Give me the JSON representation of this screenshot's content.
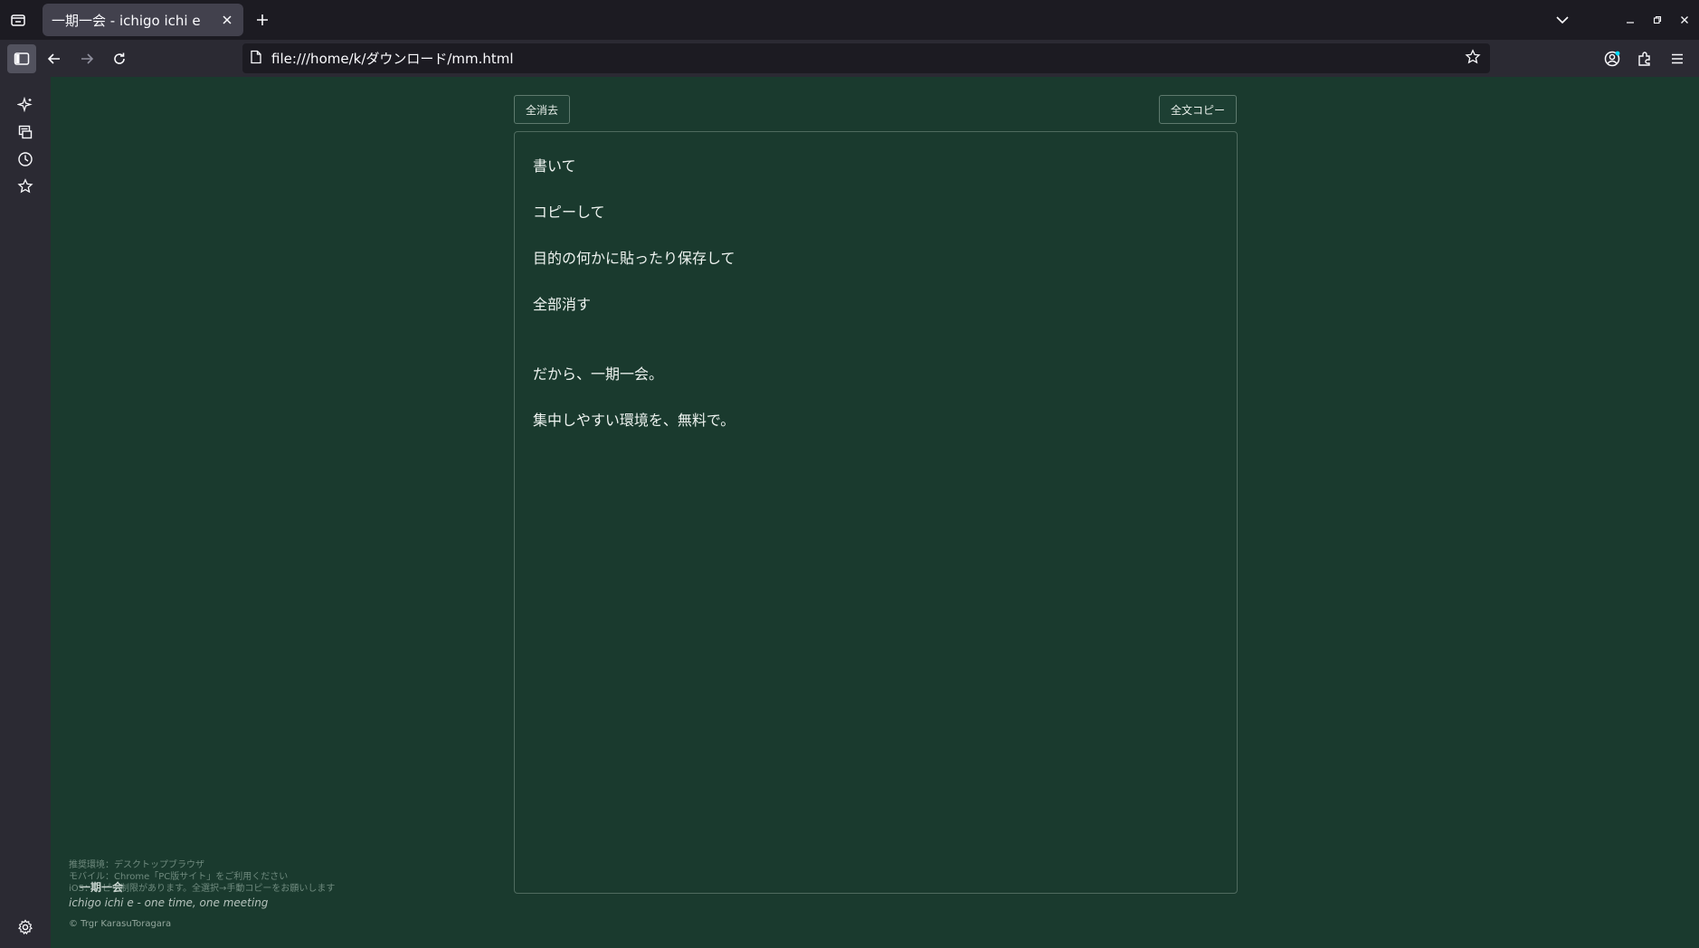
{
  "browser": {
    "tab": {
      "title": "一期一会 - ichigo ichi e"
    },
    "url": "file:///home/k/ダウンロード/mm.html"
  },
  "page": {
    "clear_button": "全消去",
    "copy_button": "全文コピー",
    "editor_lines": [
      "書いて",
      "コピーして",
      "目的の何かに貼ったり保存して",
      "全部消す",
      "だから、一期一会。",
      "集中しやすい環境を、無料で。"
    ],
    "footer": {
      "notice_1": "推奨環境：デスクトップブラウザ",
      "notice_2": "モバイル：Chrome「PC版サイト」をご利用ください",
      "notice_3": "iOS：コピー制限があります。全選択→手動コピーをお願いします",
      "brand_jp": "一期一会",
      "tagline": "ichigo ichi e - one time, one meeting",
      "copyright": "© Trgr KarasuToragara"
    }
  },
  "colors": {
    "page_background": "#1a3a2e",
    "browser_chrome": "#2b2a33",
    "tab_strip": "#1c1b22"
  }
}
